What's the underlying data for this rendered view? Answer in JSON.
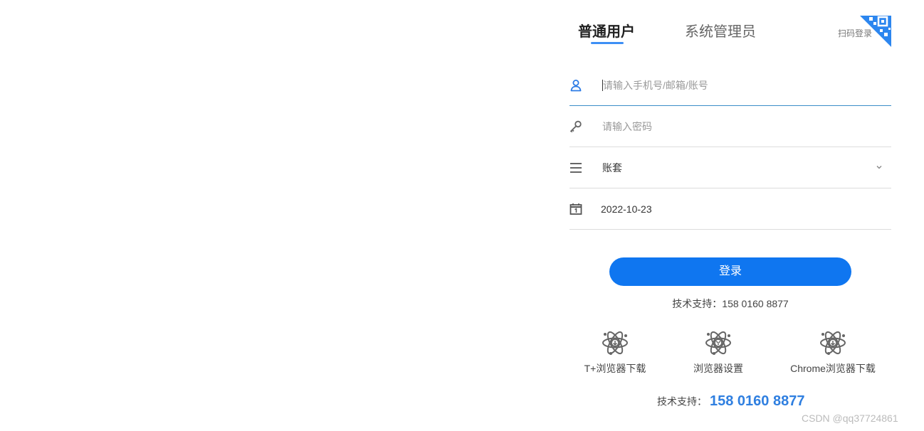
{
  "tabs": [
    {
      "label": "普通用户",
      "active": true
    },
    {
      "label": "系统管理员",
      "active": false
    }
  ],
  "qr_login": {
    "label": "扫码登录",
    "icon": "qr-code-icon"
  },
  "fields": {
    "account": {
      "icon": "user-icon",
      "placeholder": "请输入手机号/邮箱/账号",
      "value": ""
    },
    "password": {
      "icon": "key-icon",
      "placeholder": "请输入密码",
      "value": ""
    },
    "ledger": {
      "icon": "menu-icon",
      "value": "账套",
      "dropdown_icon": "chevron-down-icon"
    },
    "date": {
      "icon": "calendar-icon",
      "value": "2022-10-23"
    }
  },
  "login_button": {
    "label": "登录"
  },
  "support_line": "技术支持：158 0160 8877",
  "downloads": [
    {
      "label": "T+浏览器下载",
      "icon": "atom-download-icon"
    },
    {
      "label": "浏览器设置",
      "icon": "atom-settings-icon"
    },
    {
      "label": "Chrome浏览器下载",
      "icon": "atom-download-icon"
    }
  ],
  "support_footer": {
    "label": "技术支持：",
    "phone": "158 0160 8877"
  },
  "watermark": "CSDN @qq37724861",
  "colors": {
    "accent": "#0f76f0",
    "underline": "#3d8ff5",
    "phone": "#2f7fe0",
    "active_border": "#3b8ec8"
  }
}
